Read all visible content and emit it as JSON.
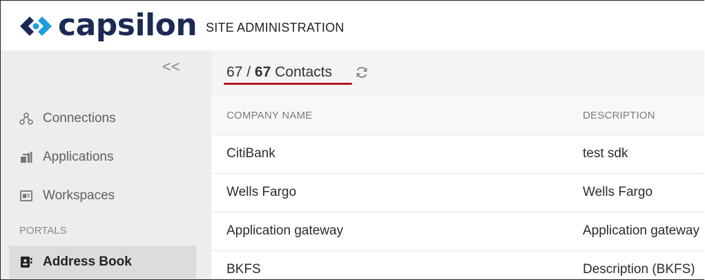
{
  "header": {
    "brand": "capsilon",
    "section_title": "SITE ADMINISTRATION",
    "brand_color": "#1b2a55",
    "accent_color": "#1f9ce0"
  },
  "sidebar": {
    "collapse_label": "<<",
    "items": [
      {
        "label": "Connections",
        "icon": "connections-icon"
      },
      {
        "label": "Applications",
        "icon": "applications-icon"
      },
      {
        "label": "Workspaces",
        "icon": "workspaces-icon"
      }
    ],
    "portals_label": "PORTALS",
    "active_item": {
      "label": "Address Book",
      "icon": "address-book-icon"
    }
  },
  "summary": {
    "shown": "67",
    "separator": "/",
    "total": "67",
    "noun": "Contacts",
    "underline_color": "#b3151c"
  },
  "table": {
    "columns": [
      "COMPANY NAME",
      "DESCRIPTION"
    ],
    "rows": [
      [
        "CitiBank",
        "test sdk"
      ],
      [
        "Wells Fargo",
        "Wells Fargo"
      ],
      [
        "Application gateway",
        "Application gateway"
      ],
      [
        "BKFS",
        "Description (BKFS)"
      ]
    ]
  }
}
